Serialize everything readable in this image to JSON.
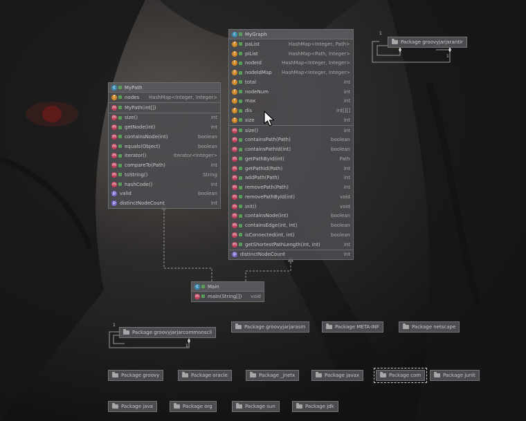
{
  "classes": {
    "mygraph": {
      "title": "MyGraph",
      "fields": [
        {
          "name": "paList",
          "type": "HashMap<Integer, Path>"
        },
        {
          "name": "piList",
          "type": "HashMap<Path, Integer>"
        },
        {
          "name": "nodeId",
          "type": "HashMap<Integer, Integer>"
        },
        {
          "name": "nodeIdMap",
          "type": "HashMap<Integer, Integer>"
        },
        {
          "name": "total",
          "type": "int"
        },
        {
          "name": "nodeNum",
          "type": "int"
        },
        {
          "name": "max",
          "type": "int"
        },
        {
          "name": "dis",
          "type": "int[][]"
        },
        {
          "name": "size",
          "type": "int"
        }
      ],
      "methods": [
        {
          "name": "size()",
          "type": "int"
        },
        {
          "name": "containsPath(Path)",
          "type": "boolean"
        },
        {
          "name": "containsPathId(int)",
          "type": "boolean"
        },
        {
          "name": "getPathById(int)",
          "type": "Path"
        },
        {
          "name": "getPathId(Path)",
          "type": "int"
        },
        {
          "name": "addPath(Path)",
          "type": "int"
        },
        {
          "name": "removePath(Path)",
          "type": "int"
        },
        {
          "name": "removePathById(int)",
          "type": "void"
        },
        {
          "name": "init()",
          "type": "void"
        },
        {
          "name": "containsNode(int)",
          "type": "boolean"
        },
        {
          "name": "containsEdge(int, int)",
          "type": "boolean"
        },
        {
          "name": "isConnected(int, int)",
          "type": "boolean"
        },
        {
          "name": "getShortestPathLength(int, int)",
          "type": "int"
        }
      ],
      "properties": [
        {
          "name": "distinctNodeCount",
          "type": "int"
        }
      ]
    },
    "mypath": {
      "title": "MyPath",
      "fields": [
        {
          "name": "nodes",
          "type": "HashMap<Integer, Integer>"
        }
      ],
      "constructors": [
        {
          "name": "MyPath(int[])",
          "type": ""
        }
      ],
      "methods": [
        {
          "name": "size()",
          "type": "int"
        },
        {
          "name": "getNode(int)",
          "type": "int"
        },
        {
          "name": "containsNode(int)",
          "type": "boolean"
        },
        {
          "name": "equals(Object)",
          "type": "boolean"
        },
        {
          "name": "iterator()",
          "type": "Iterator<Integer>"
        },
        {
          "name": "compareTo(Path)",
          "type": "int"
        },
        {
          "name": "toString()",
          "type": "String"
        },
        {
          "name": "hashCode()",
          "type": "int"
        }
      ],
      "properties": [
        {
          "name": "valid",
          "type": "boolean"
        },
        {
          "name": "distinctNodeCount",
          "type": "int"
        }
      ]
    },
    "main": {
      "title": "Main",
      "methods": [
        {
          "name": "main(String[])",
          "type": "void"
        }
      ]
    }
  },
  "packages": {
    "groovyjarjarantlr_top": "Package groovyjarjarantlr",
    "groovyjarjarcommonscli": "Package groovyjarjarcommonscli",
    "groovyjarjarasm": "Package groovyjarjarasm",
    "meta_inf": "Package META-INF",
    "netscape": "Package netscape",
    "groovy": "Package groovy",
    "oracle": "Package oracle",
    "jnetx": "Package _jnetx",
    "javax": "Package javax",
    "com": "Package com",
    "junit": "Package junit",
    "java": "Package java",
    "org": "Package org",
    "sun": "Package sun",
    "jdk": "Package jdk"
  },
  "multiplicities": {
    "one": "1"
  },
  "icons": {
    "class": "c",
    "field": "f",
    "method": "m",
    "property": "p"
  },
  "colors": {
    "field": "#d48a28",
    "method": "#c2405a",
    "class": "#3d8fb3",
    "property": "#7a66c9"
  }
}
